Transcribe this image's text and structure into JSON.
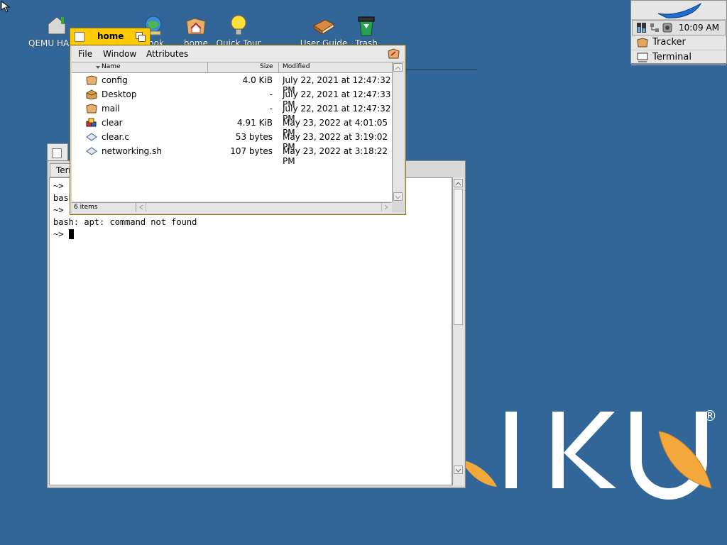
{
  "desktop": {
    "icons": [
      {
        "label": "QEMU HARDDISK",
        "icon": "disk-icon"
      },
      {
        "label": "Book",
        "icon": "globe-icon"
      },
      {
        "label": "home",
        "icon": "home-folder-icon"
      },
      {
        "label": "Quick Tour",
        "icon": "lightbulb-icon"
      },
      {
        "label": "User Guide",
        "icon": "book-icon"
      },
      {
        "label": "Trash",
        "icon": "trash-icon"
      }
    ],
    "logo_text": "HAIKU",
    "logo_reg": "®"
  },
  "deskbar": {
    "clock": "10:09 AM",
    "items": [
      {
        "label": "Tracker",
        "icon": "tracker-icon"
      },
      {
        "label": "Terminal",
        "icon": "terminal-icon"
      }
    ]
  },
  "terminal": {
    "tab_label": "Terminal",
    "lines": [
      "~> ",
      "bash",
      "~> ",
      "bash: apt: command not found",
      "~> "
    ]
  },
  "tracker": {
    "title": "home",
    "menu": [
      "File",
      "Window",
      "Attributes"
    ],
    "columns": {
      "name": "Name",
      "size": "Size",
      "modified": "Modified"
    },
    "rows": [
      {
        "name": "config",
        "size": "4.0 KiB",
        "modified": "July 22, 2021 at 12:47:32 PM",
        "icon": "folder-icon"
      },
      {
        "name": "Desktop",
        "size": "-",
        "modified": "July 22, 2021 at 12:47:33 PM",
        "icon": "desktop-folder-icon"
      },
      {
        "name": "mail",
        "size": "-",
        "modified": "July 22, 2021 at 12:47:32 PM",
        "icon": "folder-icon"
      },
      {
        "name": "clear",
        "size": "4.91 KiB",
        "modified": "May 23, 2022 at 4:01:05 PM",
        "icon": "app-icon"
      },
      {
        "name": "clear.c",
        "size": "53 bytes",
        "modified": "May 23, 2022 at 3:19:02 PM",
        "icon": "file-icon"
      },
      {
        "name": "networking.sh",
        "size": "107 bytes",
        "modified": "May 23, 2022 at 3:18:22 PM",
        "icon": "file-icon"
      }
    ],
    "status": "6 items"
  },
  "colors": {
    "desktop": "#336698",
    "tab_yellow": "#ffcb00",
    "leaf_blue": "#1c6fd1",
    "leaf_orange": "#f0a030"
  }
}
